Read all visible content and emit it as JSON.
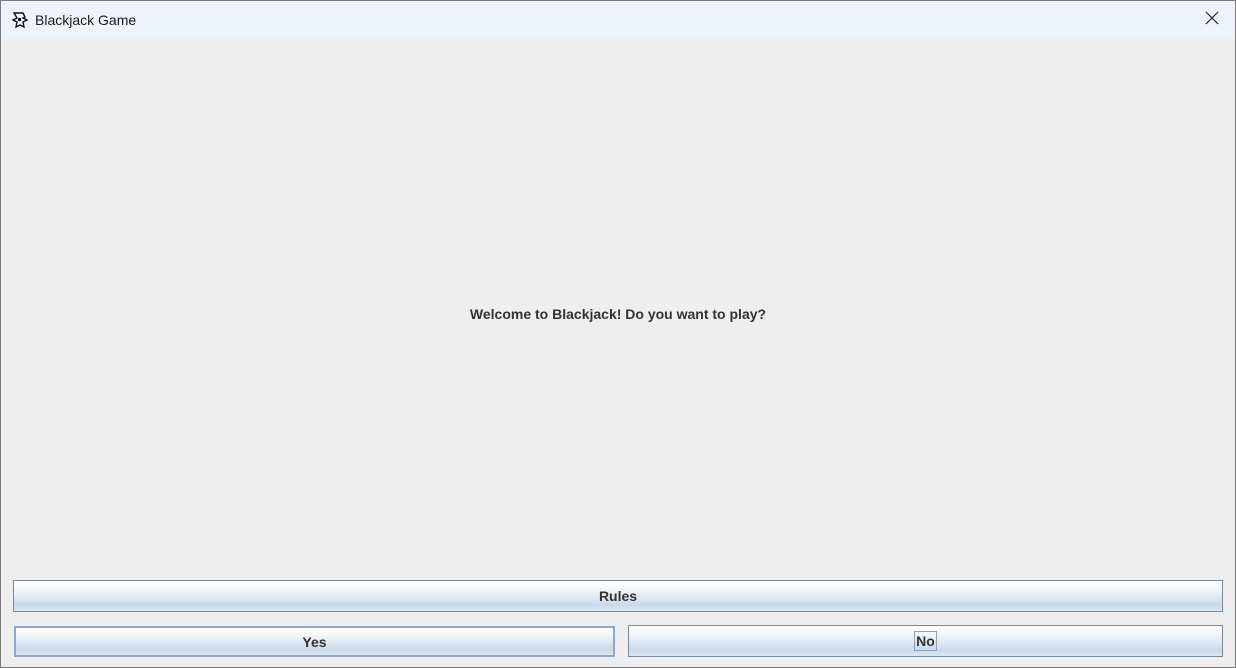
{
  "window": {
    "title": "Blackjack Game",
    "icon": "java-duke-icon"
  },
  "main": {
    "message": "Welcome to Blackjack! Do you want to play?"
  },
  "buttons": {
    "rules_label": "Rules",
    "yes_label": "Yes",
    "no_label": "No"
  },
  "colors": {
    "background": "#eeeeee",
    "titlebar": "#eef3fa",
    "text": "#333333",
    "button_border": "#7a8a99"
  }
}
